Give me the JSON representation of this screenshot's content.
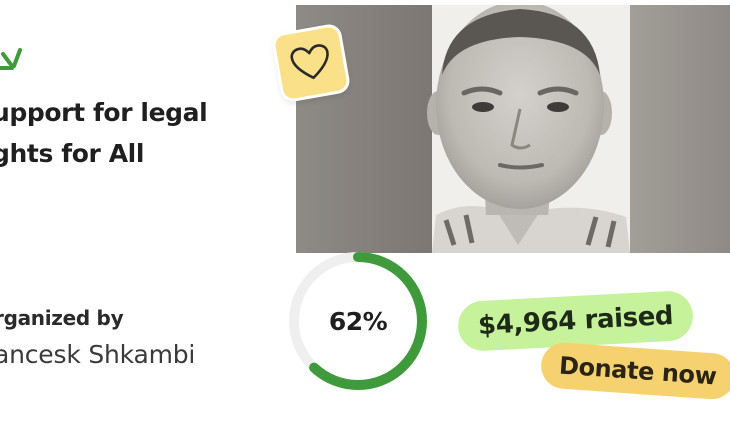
{
  "campaign": {
    "title_line1": "upport for legal",
    "title_line2": "ghts for All",
    "organizer_label": "rganized by",
    "organizer_name": "ancesk Shkambi"
  },
  "progress": {
    "label": "62%",
    "percent": 62,
    "ring_color": "#3f9a3c",
    "track_color": "#efefef"
  },
  "raised": {
    "label": "$4,964 raised",
    "color": "#c5f29a"
  },
  "donate": {
    "label": "Donate now",
    "color": "#f6d170"
  },
  "icons": {
    "sparkle": "sparkle-icon",
    "heart": "heart-icon"
  },
  "photo": {
    "subject": "organizer-portrait"
  }
}
